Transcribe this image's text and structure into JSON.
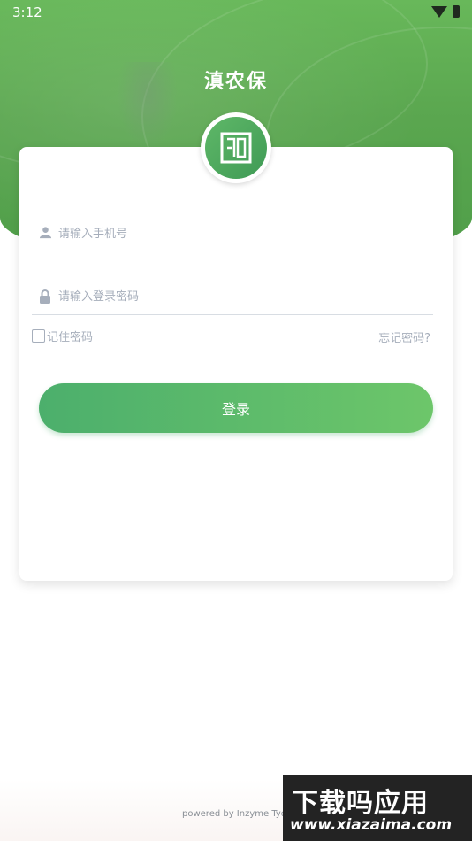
{
  "status_bar": {
    "time": "3:12"
  },
  "app": {
    "title": "滇农保"
  },
  "login": {
    "phone_placeholder": "请输入手机号",
    "password_placeholder": "请输入登录密码",
    "remember_label": "记住密码",
    "forgot_label": "忘记密码?",
    "login_label": "登录"
  },
  "footer": {
    "text": "powered by Inzyme Tyd"
  },
  "watermark": {
    "title": "下载吗应用",
    "url": "www.xiazaima.com"
  },
  "colors": {
    "primary_green": "#4caf6c",
    "placeholder": "#a6aebb"
  },
  "icons": [
    "user-icon",
    "lock-icon",
    "checkbox-icon",
    "wifi-icon",
    "battery-icon",
    "logo-icon"
  ]
}
